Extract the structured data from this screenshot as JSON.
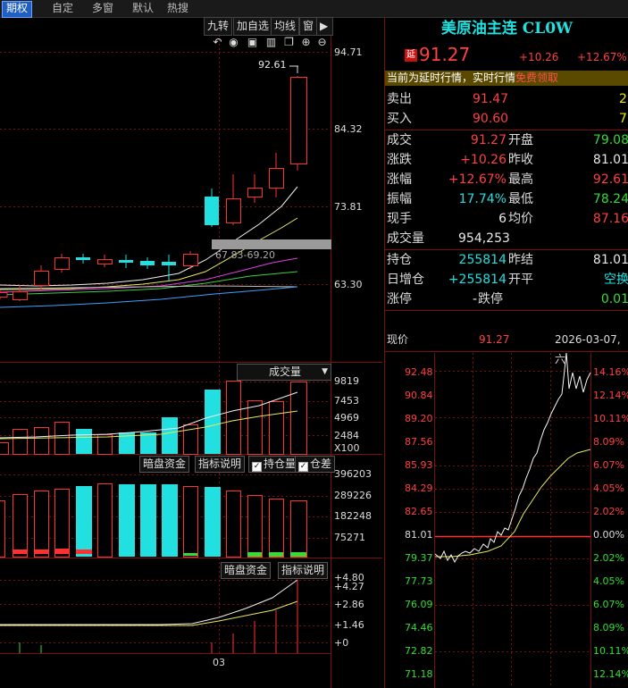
{
  "menu": [
    {
      "label": "期权",
      "active": true
    },
    {
      "label": "自定",
      "active": false
    },
    {
      "label": "多窗",
      "active": false
    },
    {
      "label": "默认",
      "active": false
    },
    {
      "label": "热搜",
      "active": false
    }
  ],
  "toolbar": {
    "b1": "九转",
    "b2": "加自选",
    "b3": "均线",
    "b4": "窗",
    "icons": [
      "eye-icon",
      "basket-icon",
      "copy-icon",
      "zoom-in-icon",
      "zoom-out-icon"
    ]
  },
  "kline": {
    "yticks": [
      "94.71",
      "84.32",
      "73.81",
      "63.30"
    ],
    "high_label": "92.61",
    "range_label": "67.83-69.20"
  },
  "volume": {
    "title": "成交量",
    "yticks": [
      "9819",
      "7453",
      "4969",
      "2484",
      "X100"
    ]
  },
  "oi": {
    "btn_dark": "暗盘资金",
    "btn_explain": "指标说明",
    "chk_hold": "持仓量",
    "chk_diff": "仓差",
    "yticks": [
      "396203",
      "289226",
      "182248",
      "75271"
    ]
  },
  "ind": {
    "btn_dark": "暗盘资金",
    "btn_explain": "指标说明",
    "yticks": [
      "+4.80",
      "+4.27",
      "+2.86",
      "+1.46",
      "+0"
    ],
    "xlabel": "03"
  },
  "quote": {
    "title": "美原油主连 CL0W",
    "badge": "延",
    "price": "91.27",
    "change": "+10.26",
    "pct": "+12.67%",
    "notice": "当前为延时行情，实时行情",
    "notice_link": "免费领取",
    "sell_label": "卖出",
    "sell_price": "91.47",
    "sell_vol": "2",
    "buy_label": "买入",
    "buy_price": "90.60",
    "buy_vol": "7",
    "rows": [
      {
        "l1": "成交",
        "v1": "91.27",
        "c1": "red",
        "l2": "开盘",
        "v2": "79.08",
        "c2": "green"
      },
      {
        "l1": "涨跌",
        "v1": "+10.26",
        "c1": "red",
        "l2": "昨收",
        "v2": "81.01",
        "c2": "white"
      },
      {
        "l1": "涨幅",
        "v1": "+12.67%",
        "c1": "red",
        "l2": "最高",
        "v2": "92.61",
        "c2": "red"
      },
      {
        "l1": "振幅",
        "v1": "17.74%",
        "c1": "cyan",
        "l2": "最低",
        "v2": "78.24",
        "c2": "green"
      },
      {
        "l1": "现手",
        "v1": "6",
        "c1": "white",
        "l2": "均价",
        "v2": "87.16",
        "c2": "red"
      }
    ],
    "vol_label": "成交量",
    "vol_value": "954,253",
    "hold_label": "持仓",
    "hold_value": "255814",
    "prev_settle_label": "昨结",
    "prev_settle_value": "81.01",
    "daily_label": "日增仓",
    "daily_value": "+255814",
    "open_close_label": "开平",
    "open_close_value": "空换",
    "limit_up_label": "涨停",
    "limit_up_value": "-",
    "limit_down_label": "跌停",
    "limit_down_value": "0.01",
    "now_label": "现价",
    "now_value": "91.27",
    "datetime": "2026-03-07,六"
  },
  "intraday": {
    "left_ticks": [
      "92.48",
      "90.84",
      "89.20",
      "87.56",
      "85.93",
      "84.29",
      "82.65",
      "81.01",
      "79.37",
      "77.73",
      "76.09",
      "74.46",
      "72.82",
      "71.18"
    ],
    "right_ticks": [
      "14.16%",
      "12.14%",
      "10.11%",
      "8.09%",
      "6.07%",
      "4.05%",
      "2.02%",
      "0.00%",
      "2.02%",
      "4.05%",
      "6.07%",
      "8.09%",
      "10.11%",
      "12.14%"
    ]
  },
  "colors": {
    "up": "#ff3030",
    "down": "#22e0e0",
    "bg": "#000000",
    "grid": "#7a1010",
    "accent": "#1f5fbf"
  }
}
